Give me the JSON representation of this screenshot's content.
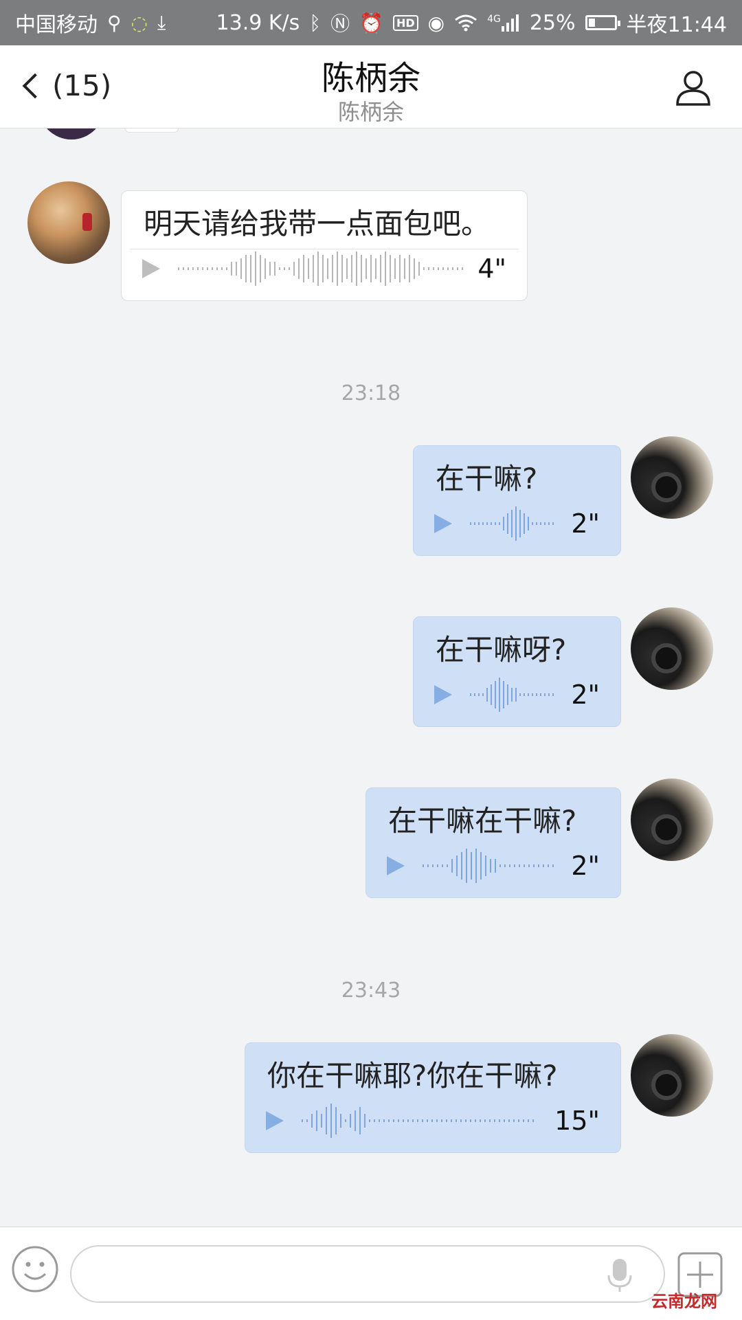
{
  "status_bar": {
    "carrier": "中国移动",
    "speed": "13.9 K/s",
    "network": "4G",
    "battery": "25%",
    "battery_level": 0.25,
    "time": "半夜11:44"
  },
  "header": {
    "back_label": "(15)",
    "title": "陈柄余",
    "subtitle": "陈柄余"
  },
  "messages": [
    {
      "direction": "in",
      "text": "明天请给我带一点面包吧。",
      "duration": "4\""
    },
    {
      "timestamp": "23:18"
    },
    {
      "direction": "out",
      "text": "在干嘛?",
      "duration": "2\""
    },
    {
      "direction": "out",
      "text": "在干嘛呀?",
      "duration": "2\""
    },
    {
      "direction": "out",
      "text": "在干嘛在干嘛?",
      "duration": "2\""
    },
    {
      "timestamp": "23:43"
    },
    {
      "direction": "out",
      "text": "你在干嘛耶?你在干嘛?",
      "duration": "15\""
    }
  ],
  "timestamps": [
    "23:18",
    "23:43"
  ],
  "watermark": "云南龙网",
  "colors": {
    "background": "#f2f3f5",
    "outgoing_bubble": "#cfe0f6",
    "incoming_bubble": "#ffffff",
    "status_bar": "#7c7d7f"
  },
  "icons": {
    "back": "chevron-left-icon",
    "profile": "user-icon",
    "emoji": "smiley-icon",
    "mic": "microphone-icon",
    "plus": "plus-icon",
    "play": "play-icon"
  }
}
